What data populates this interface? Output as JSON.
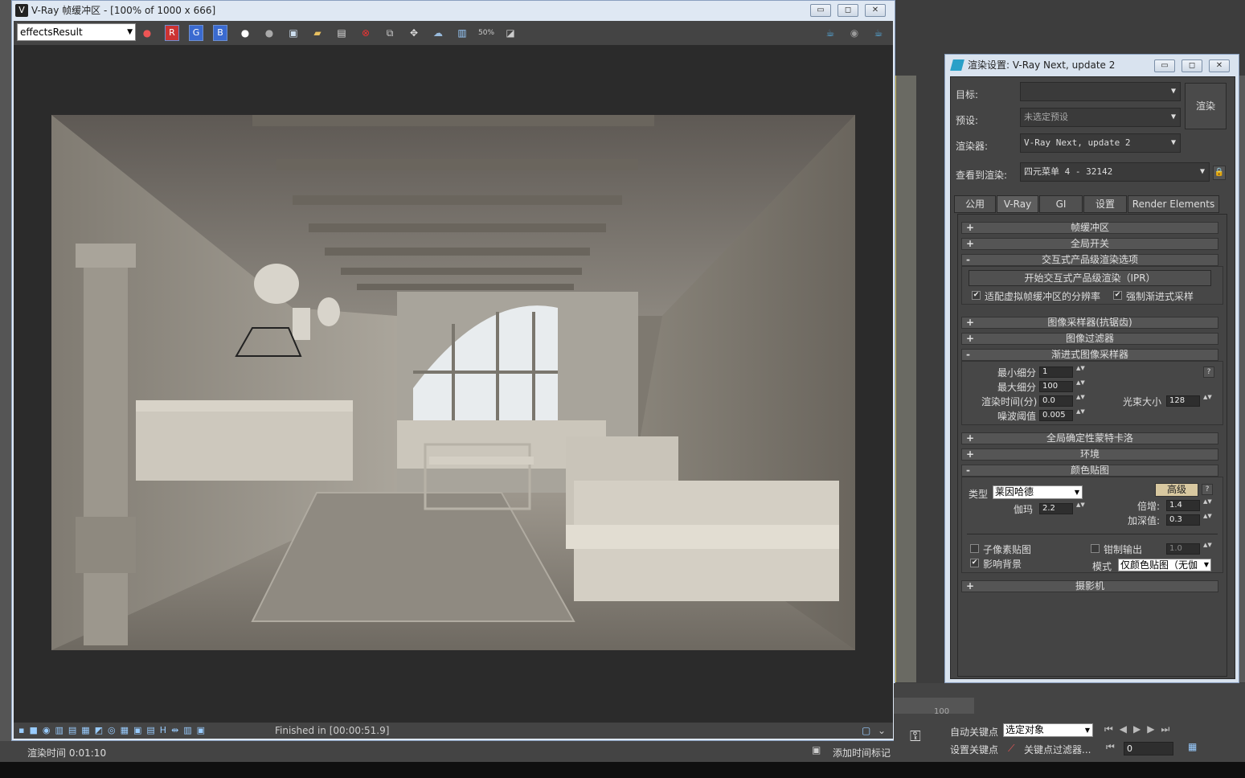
{
  "vfb": {
    "title": "V-Ray 帧缓冲区 - [100% of 1000 x 666]",
    "channel": "effectsResult",
    "rgb": [
      "R",
      "G",
      "B"
    ],
    "status": "Finished in [00:00:51.9]"
  },
  "render_settings": {
    "title": "渲染设置: V-Ray Next, update 2",
    "target_label": "目标:",
    "target_value": "",
    "preset_label": "预设:",
    "preset_value": "未选定预设",
    "renderer_label": "渲染器:",
    "renderer_value": "V-Ray Next, update 2",
    "view_label": "查看到渲染:",
    "view_value": "四元菜单 4 - 32142",
    "render_button": "渲染",
    "tabs": [
      "公用",
      "V-Ray",
      "GI",
      "设置",
      "Render Elements"
    ],
    "active_tab": "V-Ray",
    "rollouts": {
      "frame_buffer": "帧缓冲区",
      "global_switches": "全局开关",
      "ipr": "交互式产品级渲染选项",
      "ipr_start": "开始交互式产品级渲染（IPR）",
      "ipr_fit": "适配虚拟帧缓冲区的分辨率",
      "ipr_force": "强制渐进式采样",
      "image_sampler": "图像采样器(抗锯齿)",
      "image_filter": "图像过滤器",
      "progressive": "渐进式图像采样器",
      "global_dmc": "全局确定性蒙特卡洛",
      "environment": "环境",
      "color_mapping": "颜色贴图",
      "camera": "摄影机"
    },
    "progressive_fields": {
      "min_subdivs_label": "最小细分",
      "min_subdivs": "1",
      "max_subdivs_label": "最大细分",
      "max_subdivs": "100",
      "render_time_label": "渲染时间(分)",
      "render_time": "0.0",
      "noise_label": "噪波阈值",
      "noise": "0.005",
      "bundle_label": "光束大小",
      "bundle": "128",
      "help": "?"
    },
    "color_mapping_fields": {
      "type_label": "类型",
      "type_value": "莱因哈德",
      "advanced": "高级",
      "help": "?",
      "gamma_label": "伽玛",
      "gamma": "2.2",
      "multiplier_label": "倍增:",
      "multiplier": "1.4",
      "burn_label": "加深值:",
      "burn": "0.3",
      "subpixel_label": "子像素贴图",
      "clamp_label": "钳制输出",
      "clamp_value": "1.0",
      "affect_bg_label": "影响背景",
      "mode_label": "模式",
      "mode_value": "仅颜色贴图（无伽"
    }
  },
  "bottom": {
    "render_time": "渲染时间  0:01:10",
    "add_time_tag": "添加时间标记",
    "auto_key": "自动关键点",
    "set_key": "设置关键点",
    "selection": "选定对象",
    "key_filters": "关键点过滤器...",
    "frame": "0",
    "timeline_100": "100"
  },
  "colors": {
    "accent_frame": "#c8b044",
    "ui_dark": "#444444",
    "window_chrome": "#dee8f4"
  }
}
